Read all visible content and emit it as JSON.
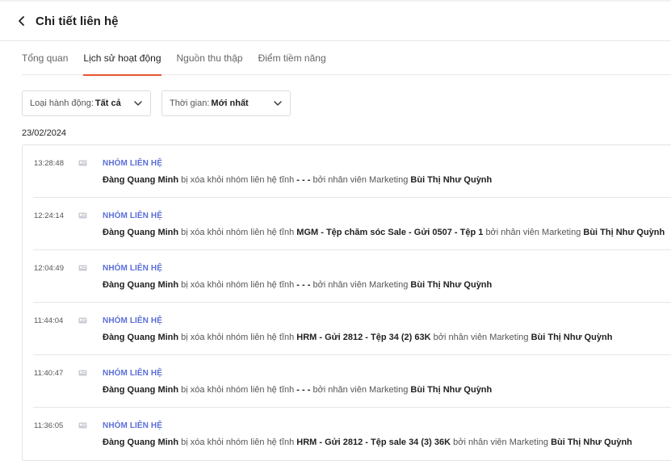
{
  "header": {
    "title": "Chi tiết liên hệ"
  },
  "tabs": [
    {
      "label": "Tổng quan",
      "active": false
    },
    {
      "label": "Lịch sử hoạt động",
      "active": true
    },
    {
      "label": "Nguồn thu thập",
      "active": false
    },
    {
      "label": "Điểm tiềm năng",
      "active": false
    }
  ],
  "filters": {
    "action_type": {
      "label": "Loại hành động:",
      "value": "Tất cả"
    },
    "time": {
      "label": "Thời gian:",
      "value": "Mới nhất"
    }
  },
  "date": "23/02/2024",
  "accent_color": "#e8542f",
  "category_color": "#5b6fd8",
  "activities": [
    {
      "time": "13:28:48",
      "category": "NHÓM LIÊN HỆ",
      "contact": "Đàng Quang Minh",
      "action": "bị xóa khỏi nhóm liên hệ tĩnh",
      "group": "- - -",
      "by": "bởi nhân viên Marketing",
      "staff": "Bùi Thị Như Quỳnh"
    },
    {
      "time": "12:24:14",
      "category": "NHÓM LIÊN HỆ",
      "contact": "Đàng Quang Minh",
      "action": "bị xóa khỏi nhóm liên hệ tĩnh",
      "group": "MGM - Tệp chăm sóc Sale - Gửi 0507 - Tệp 1",
      "by": "bởi nhân viên Marketing",
      "staff": "Bùi Thị Như Quỳnh"
    },
    {
      "time": "12:04:49",
      "category": "NHÓM LIÊN HỆ",
      "contact": "Đàng Quang Minh",
      "action": "bị xóa khỏi nhóm liên hệ tĩnh",
      "group": "- - -",
      "by": "bởi nhân viên Marketing",
      "staff": "Bùi Thị Như Quỳnh"
    },
    {
      "time": "11:44:04",
      "category": "NHÓM LIÊN HỆ",
      "contact": "Đàng Quang Minh",
      "action": "bị xóa khỏi nhóm liên hệ tĩnh",
      "group": "HRM - Gửi 2812 - Tệp 34 (2) 63K",
      "by": "bởi nhân viên Marketing",
      "staff": "Bùi Thị Như Quỳnh"
    },
    {
      "time": "11:40:47",
      "category": "NHÓM LIÊN HỆ",
      "contact": "Đàng Quang Minh",
      "action": "bị xóa khỏi nhóm liên hệ tĩnh",
      "group": "- - -",
      "by": "bởi nhân viên Marketing",
      "staff": "Bùi Thị Như Quỳnh"
    },
    {
      "time": "11:36:05",
      "category": "NHÓM LIÊN HỆ",
      "contact": "Đàng Quang Minh",
      "action": "bị xóa khỏi nhóm liên hệ tĩnh",
      "group": "HRM - Gửi 2812 - Tệp sale 34 (3) 36K",
      "by": "bởi nhân viên Marketing",
      "staff": "Bùi Thị Như Quỳnh"
    }
  ]
}
